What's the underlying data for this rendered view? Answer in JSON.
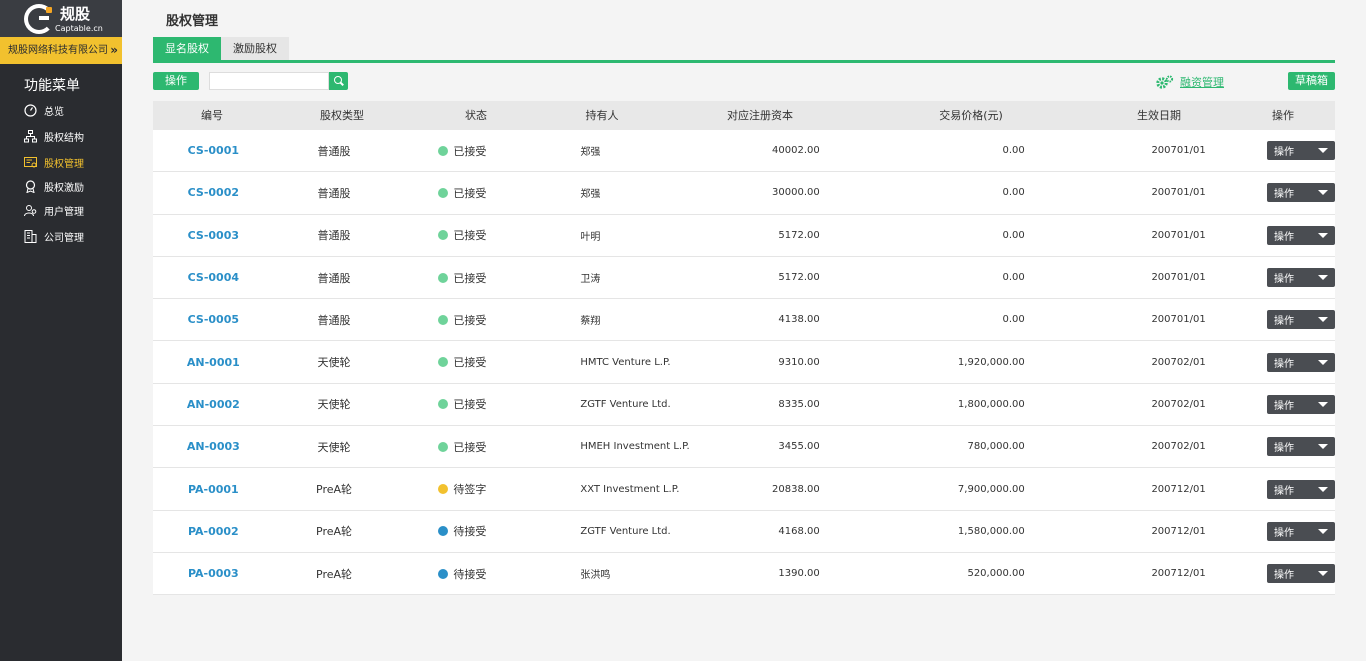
{
  "brand": {
    "name": "规股",
    "sub": "Captable.cn"
  },
  "company": {
    "name": "规股网络科技有限公司",
    "arrow": "»"
  },
  "menu": {
    "title": "功能菜单",
    "items": [
      {
        "label": "总览",
        "icon": "dashboard-icon"
      },
      {
        "label": "股权结构",
        "icon": "org-structure-icon"
      },
      {
        "label": "股权管理",
        "icon": "certificate-icon",
        "active": true
      },
      {
        "label": "股权激励",
        "icon": "award-icon"
      },
      {
        "label": "用户管理",
        "icon": "users-icon"
      },
      {
        "label": "公司管理",
        "icon": "building-icon"
      }
    ]
  },
  "page_title": "股权管理",
  "tabs": [
    {
      "label": "显名股权",
      "active": true
    },
    {
      "label": "激励股权"
    }
  ],
  "toolbar": {
    "op_label": "操作",
    "search_value": "",
    "finance_label": "融资管理",
    "draft_label": "草稿箱"
  },
  "table": {
    "headers": [
      "编号",
      "股权类型",
      "状态",
      "持有人",
      "对应注册资本",
      "交易价格(元)",
      "生效日期",
      "操作"
    ],
    "rows": [
      {
        "id": "CS-0001",
        "type": "普通股",
        "status": "已接受",
        "status_color": "#6fd39a",
        "holder": "郑强",
        "capital": "40002.00",
        "price": "0.00",
        "date": "200701/01",
        "op": "操作"
      },
      {
        "id": "CS-0002",
        "type": "普通股",
        "status": "已接受",
        "status_color": "#6fd39a",
        "holder": "郑强",
        "capital": "30000.00",
        "price": "0.00",
        "date": "200701/01",
        "op": "操作"
      },
      {
        "id": "CS-0003",
        "type": "普通股",
        "status": "已接受",
        "status_color": "#6fd39a",
        "holder": "叶明",
        "capital": "5172.00",
        "price": "0.00",
        "date": "200701/01",
        "op": "操作"
      },
      {
        "id": "CS-0004",
        "type": "普通股",
        "status": "已接受",
        "status_color": "#6fd39a",
        "holder": "卫涛",
        "capital": "5172.00",
        "price": "0.00",
        "date": "200701/01",
        "op": "操作"
      },
      {
        "id": "CS-0005",
        "type": "普通股",
        "status": "已接受",
        "status_color": "#6fd39a",
        "holder": "蔡翔",
        "capital": "4138.00",
        "price": "0.00",
        "date": "200701/01",
        "op": "操作"
      },
      {
        "id": "AN-0001",
        "type": "天使轮",
        "status": "已接受",
        "status_color": "#6fd39a",
        "holder": "HMTC Venture L.P.",
        "capital": "9310.00",
        "price": "1,920,000.00",
        "date": "200702/01",
        "op": "操作"
      },
      {
        "id": "AN-0002",
        "type": "天使轮",
        "status": "已接受",
        "status_color": "#6fd39a",
        "holder": "ZGTF Venture Ltd.",
        "capital": "8335.00",
        "price": "1,800,000.00",
        "date": "200702/01",
        "op": "操作"
      },
      {
        "id": "AN-0003",
        "type": "天使轮",
        "status": "已接受",
        "status_color": "#6fd39a",
        "holder": "HMEH Investment L.P.",
        "capital": "3455.00",
        "price": "780,000.00",
        "date": "200702/01",
        "op": "操作"
      },
      {
        "id": "PA-0001",
        "type": "PreA轮",
        "status": "待签字",
        "status_color": "#f2c12e",
        "holder": "XXT Investment L.P.",
        "capital": "20838.00",
        "price": "7,900,000.00",
        "date": "200712/01",
        "op": "操作"
      },
      {
        "id": "PA-0002",
        "type": "PreA轮",
        "status": "待接受",
        "status_color": "#2a8fc8",
        "holder": "ZGTF Venture Ltd.",
        "capital": "4168.00",
        "price": "1,580,000.00",
        "date": "200712/01",
        "op": "操作"
      },
      {
        "id": "PA-0003",
        "type": "PreA轮",
        "status": "待接受",
        "status_color": "#2a8fc8",
        "holder": "张洪鸣",
        "capital": "1390.00",
        "price": "520,000.00",
        "date": "200712/01",
        "op": "操作"
      }
    ]
  },
  "colors": {
    "accent": "#2db870",
    "sidebar": "#2a2c30",
    "company_bar": "#f2c12e",
    "link": "#2a8fc8"
  }
}
